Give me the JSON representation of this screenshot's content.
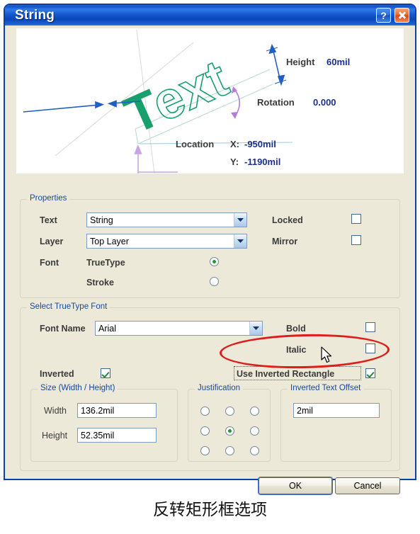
{
  "window": {
    "title": "String",
    "help_button": "?",
    "close_button": "close-icon"
  },
  "preview": {
    "sample_text": "Text",
    "height_label": "Height",
    "height_value": "60mil",
    "rotation_label": "Rotation",
    "rotation_value": "0.000",
    "location_label": "Location",
    "location_x_label": "X:",
    "location_x_value": "-950mil",
    "location_y_label": "Y:",
    "location_y_value": "-1190mil"
  },
  "properties": {
    "group_label": "Properties",
    "text_label": "Text",
    "text_value": "String",
    "layer_label": "Layer",
    "layer_value": "Top Layer",
    "font_label": "Font",
    "truetype_label": "TrueType",
    "stroke_label": "Stroke",
    "font_selected": "TrueType",
    "locked_label": "Locked",
    "locked_checked": false,
    "mirror_label": "Mirror",
    "mirror_checked": false
  },
  "truetype": {
    "group_label": "Select TrueType Font",
    "font_name_label": "Font Name",
    "font_name_value": "Arial",
    "bold_label": "Bold",
    "bold_checked": false,
    "italic_label": "Italic",
    "italic_checked": false,
    "inverted_label": "Inverted",
    "inverted_checked": true,
    "use_inverted_rectangle_label": "Use Inverted Rectangle",
    "use_inverted_rectangle_checked": true
  },
  "size": {
    "group_label": "Size (Width / Height)",
    "width_label": "Width",
    "width_value": "136.2mil",
    "height_label": "Height",
    "height_value": "52.35mil"
  },
  "justification": {
    "group_label": "Justification",
    "selected_index": 4,
    "cells": [
      "top-left",
      "top-center",
      "top-right",
      "middle-left",
      "middle-center",
      "middle-right",
      "bottom-left",
      "bottom-center",
      "bottom-right"
    ]
  },
  "inverted_text_offset": {
    "group_label": "Inverted Text Offset",
    "value": "2mil"
  },
  "buttons": {
    "ok": "OK",
    "cancel": "Cancel"
  },
  "annotation": {
    "caption": "反转矩形框选项",
    "highlight_color": "#e01b1b"
  },
  "colors": {
    "titlebar_blue": "#1355c9",
    "dialog_face": "#ece9d8",
    "group_label_blue": "#15489c",
    "check_green": "#1f8a36",
    "preview_text_green": "#1aa06a",
    "preview_value_navy": "#1c2f8f",
    "dimension_blue": "#1f5fbf",
    "dimension_violet": "#b07ed8"
  }
}
